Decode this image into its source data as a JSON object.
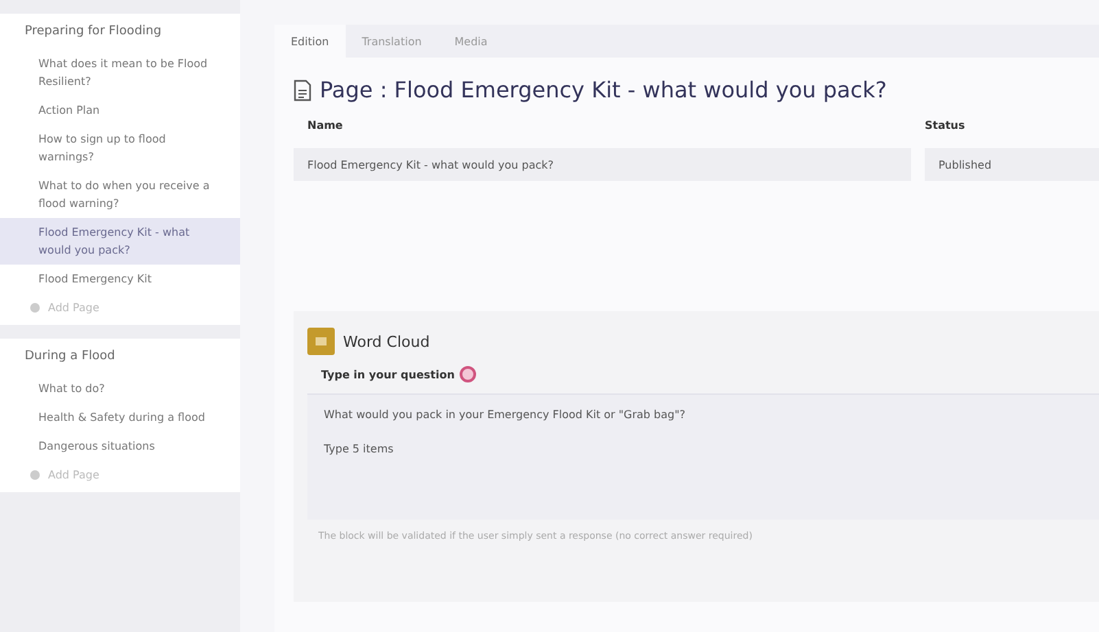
{
  "sidebar": {
    "sections": [
      {
        "title": "Preparing for Flooding",
        "items": [
          {
            "label": "What does it mean to be Flood Resilient?",
            "selected": false
          },
          {
            "label": "Action Plan",
            "selected": false
          },
          {
            "label": "How to sign up to flood warnings?",
            "selected": false
          },
          {
            "label": "What to do when you receive a flood warning?",
            "selected": false
          },
          {
            "label": "Flood Emergency Kit - what would you pack?",
            "selected": true
          },
          {
            "label": "Flood Emergency Kit",
            "selected": false
          }
        ],
        "add_label": "Add Page"
      },
      {
        "title": "During a Flood",
        "items": [
          {
            "label": "What to do?",
            "selected": false
          },
          {
            "label": "Health & Safety during a flood",
            "selected": false
          },
          {
            "label": "Dangerous situations",
            "selected": false
          }
        ],
        "add_label": "Add Page"
      }
    ]
  },
  "tabs": [
    {
      "label": "Edition",
      "selected": true
    },
    {
      "label": "Translation",
      "selected": false
    },
    {
      "label": "Media",
      "selected": false
    }
  ],
  "page_title": "Page : Flood Emergency Kit - what would you pack?",
  "table": {
    "columns": [
      "Name",
      "Status"
    ],
    "rows": [
      [
        "Flood Emergency Kit - what would you pack?",
        "Published"
      ]
    ]
  },
  "block": {
    "title": "Word Cloud",
    "question_label": "Type in your question",
    "question_lines": [
      "What would you pack in your Emergency Flood Kit or \"Grab bag\"?",
      "Type 5 items"
    ],
    "note": "The block will be validated if the user simply sent a response (no correct answer required)"
  }
}
